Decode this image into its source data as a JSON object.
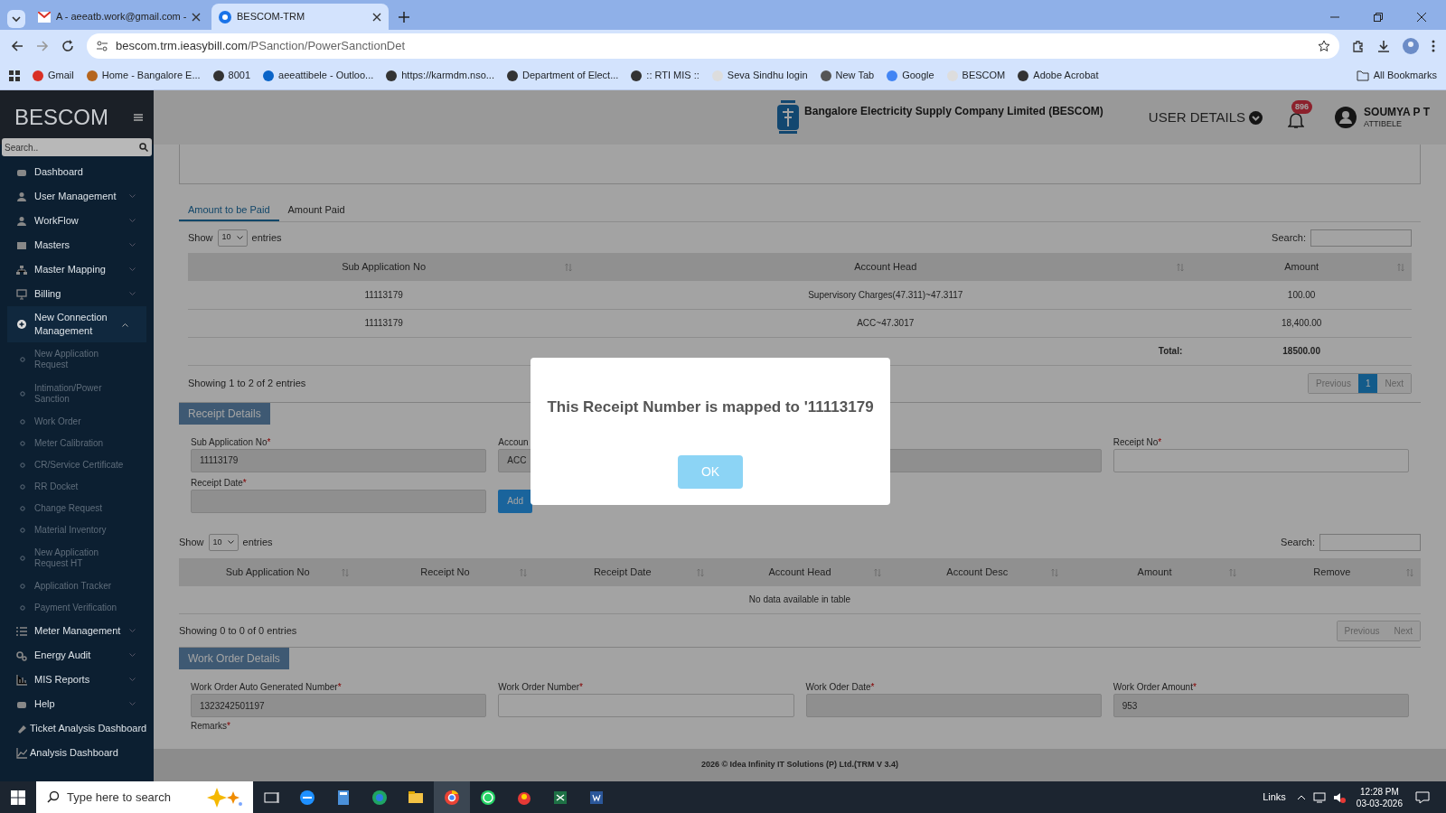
{
  "browser": {
    "tabs": [
      {
        "title": "A - aeeatb.work@gmail.com - ",
        "selected": false
      },
      {
        "title": "BESCOM-TRM",
        "selected": true
      }
    ],
    "address": {
      "host": "bescom.trm.ieasybill.com",
      "path": "/PSanction/PowerSanctionDet"
    },
    "bookmarks": [
      "Gmail",
      "Home - Bangalore E...",
      "8001",
      "aeeattibele - Outloo...",
      "https://karmdm.nso...",
      "Department of Elect...",
      ":: RTI MIS ::",
      "Seva Sindhu login",
      "New Tab",
      "Google",
      "BESCOM",
      "Adobe Acrobat"
    ],
    "all_bookmarks": "All Bookmarks"
  },
  "sidebar": {
    "brand": "BESCOM",
    "search": {
      "placeholder": "Search.."
    },
    "items": [
      {
        "label": "Dashboard",
        "kind": "link"
      },
      {
        "label": "User Management",
        "kind": "group",
        "expanded": false
      },
      {
        "label": "WorkFlow",
        "kind": "group",
        "expanded": false
      },
      {
        "label": "Masters",
        "kind": "group",
        "expanded": false
      },
      {
        "label": "Master Mapping",
        "kind": "group",
        "expanded": false
      },
      {
        "label": "Billing",
        "kind": "group",
        "expanded": false
      },
      {
        "label": "New Connection Management",
        "kind": "group",
        "expanded": true,
        "children": [
          "New Application Request",
          "Intimation/Power Sanction",
          "Work Order",
          "Meter Calibration",
          "CR/Service Certificate",
          "RR Docket",
          "Change Request",
          "Material Inventory",
          "New Application Request HT",
          "Application Tracker",
          "Payment Verification"
        ]
      },
      {
        "label": "Meter Management",
        "kind": "group",
        "expanded": false
      },
      {
        "label": "Energy Audit",
        "kind": "group",
        "expanded": false
      },
      {
        "label": "MIS Reports",
        "kind": "group",
        "expanded": false
      },
      {
        "label": "Help",
        "kind": "group",
        "expanded": false
      },
      {
        "label": "Ticket Analysis Dashboard",
        "kind": "link"
      },
      {
        "label": "Analysis Dashboard",
        "kind": "link"
      }
    ]
  },
  "header": {
    "company": "Bangalore Electricity Supply Company Limited (BESCOM)",
    "user_details": "USER DETAILS",
    "notifications": "896",
    "user": {
      "name": "SOUMYA P T",
      "location": "ATTIBELE"
    }
  },
  "payment_tabs": [
    {
      "label": "Amount to be Paid",
      "selected": true
    },
    {
      "label": "Amount Paid",
      "selected": false
    }
  ],
  "amount_table": {
    "show": "Show",
    "page_size": "10",
    "entries": "entries",
    "search_label": "Search:",
    "columns": [
      "Sub Application No",
      "Account Head",
      "Amount"
    ],
    "rows": [
      [
        "11113179",
        "Supervisory Charges(47.311)~47.3117",
        "100.00"
      ],
      [
        "11113179",
        "ACC~47.3017",
        "18,400.00"
      ]
    ],
    "total_label": "Total:",
    "total": "18500.00",
    "info": "Showing 1 to 2 of 2 entries",
    "pagination": {
      "previous": "Previous",
      "pages": [
        {
          "label": "1",
          "selected": true
        }
      ],
      "next": "Next"
    }
  },
  "receipt": {
    "title": "Receipt Details",
    "fields": [
      {
        "label": "Sub Application No",
        "required_mark": "*",
        "value": "11113179",
        "readonly": true
      },
      {
        "label": "Accoun",
        "value": "ACC",
        "readonly": true
      },
      {
        "readonly": true
      },
      {
        "label": "Receipt No",
        "required_mark": "*",
        "readonly": false
      },
      {
        "label": "Receipt Date",
        "required_mark": "*",
        "readonly": true
      }
    ],
    "add": "Add"
  },
  "receipt_table": {
    "show": "Show",
    "page_size": "10",
    "entries": "entries",
    "search_label": "Search:",
    "columns": [
      "Sub Application No",
      "Receipt No",
      "Receipt Date",
      "Account Head",
      "Account Desc",
      "Amount",
      "Remove"
    ],
    "empty": "No data available in table",
    "info": "Showing 0 to 0 of 0 entries",
    "previous": "Previous",
    "next": "Next"
  },
  "work_order": {
    "title": "Work Order Details",
    "fields": [
      {
        "label": "Work Order Auto Generated Number",
        "required_mark": "*",
        "value": "1323242501197",
        "readonly": true
      },
      {
        "label": "Work Order Number",
        "required_mark": "*",
        "readonly": false
      },
      {
        "label": "Work Oder Date",
        "required_mark": "*",
        "readonly": true
      },
      {
        "label": "Work Order Amount",
        "required_mark": "*",
        "value": "953",
        "readonly": true
      }
    ],
    "remarks": {
      "label": "Remarks",
      "required_mark": "*"
    }
  },
  "footer": "2026 © Idea Infinity IT Solutions (P) Ltd.(TRM V 3.4)",
  "dialog": {
    "message": "This Receipt Number is mapped to '11113179",
    "ok": "OK"
  },
  "taskbar": {
    "search": {
      "placeholder": "Type here to search"
    },
    "links": "Links",
    "time": "12:28 PM",
    "date": "03-03-2026"
  }
}
